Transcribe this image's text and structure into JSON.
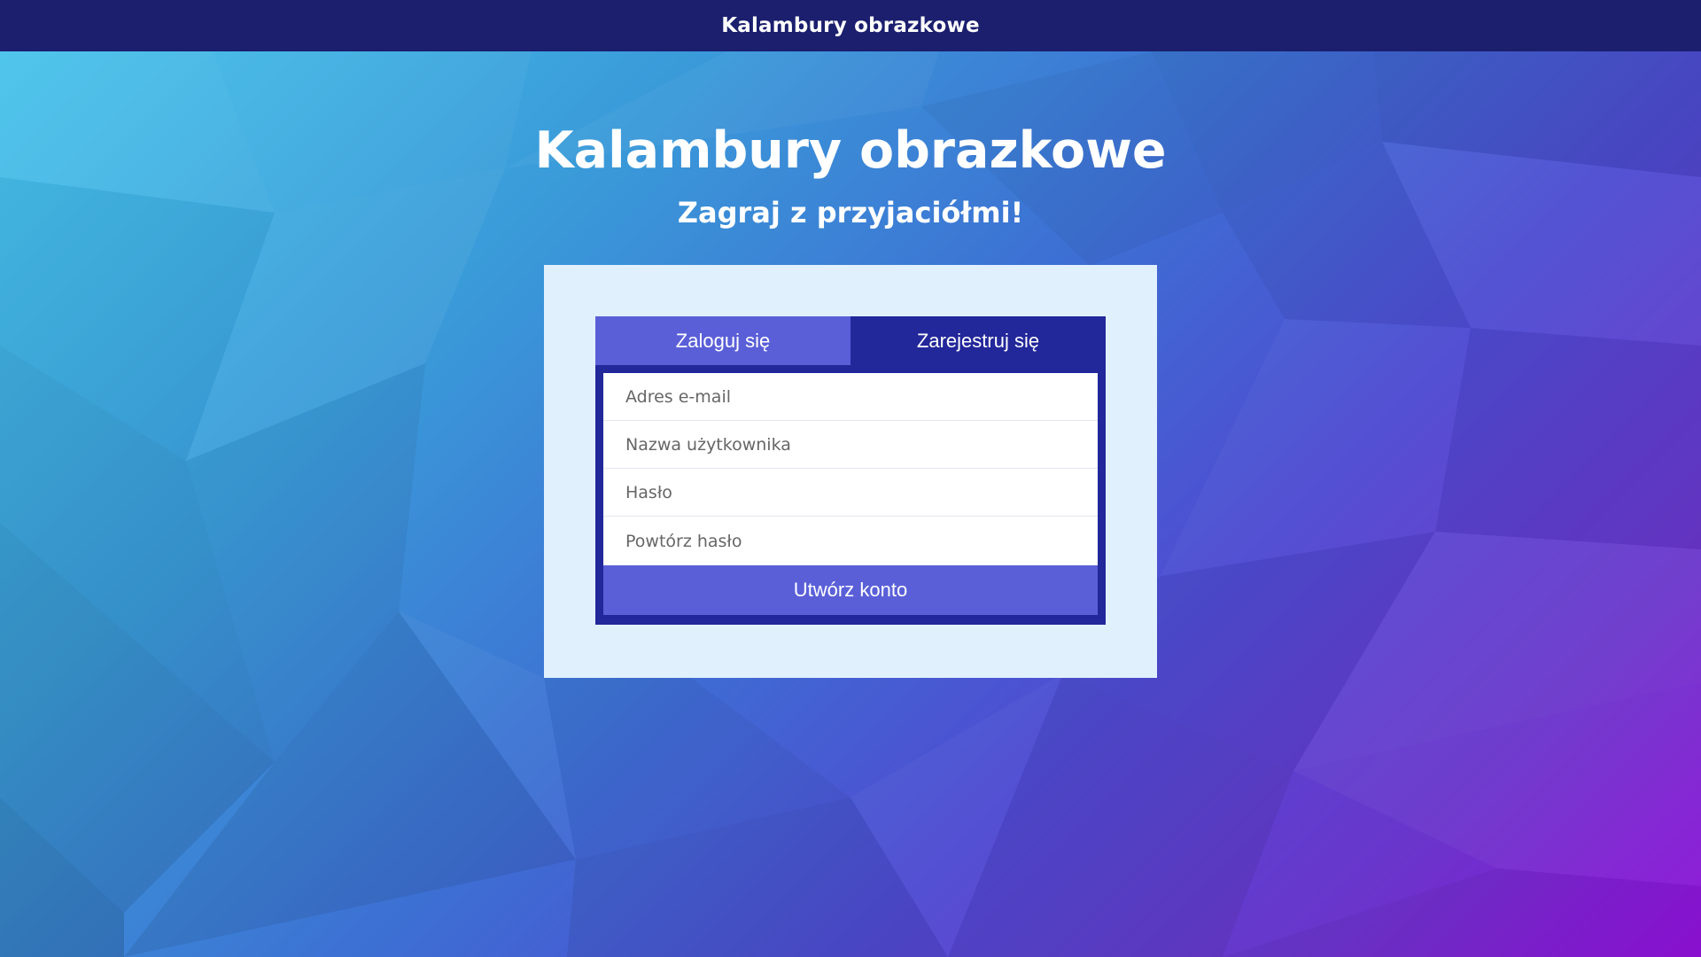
{
  "header": {
    "title": "Kalambury obrazkowe"
  },
  "hero": {
    "title": "Kalambury obrazkowe",
    "subtitle": "Zagraj z przyjaciółmi!"
  },
  "auth": {
    "tabs": [
      {
        "label": "Zaloguj się",
        "active": false
      },
      {
        "label": "Zarejestruj się",
        "active": true
      }
    ],
    "fields": {
      "email": {
        "placeholder": "Adres e-mail",
        "value": ""
      },
      "username": {
        "placeholder": "Nazwa użytkownika",
        "value": ""
      },
      "password": {
        "placeholder": "Hasło",
        "value": ""
      },
      "password_repeat": {
        "placeholder": "Powtórz hasło",
        "value": ""
      }
    },
    "submit_label": "Utwórz konto"
  },
  "colors": {
    "topbar": "#1b1f6e",
    "card": "#e0f0fd",
    "form_border": "#22279a",
    "accent": "#5a5fd8",
    "background_start": "#47c6ec",
    "background_end": "#9010d8"
  }
}
